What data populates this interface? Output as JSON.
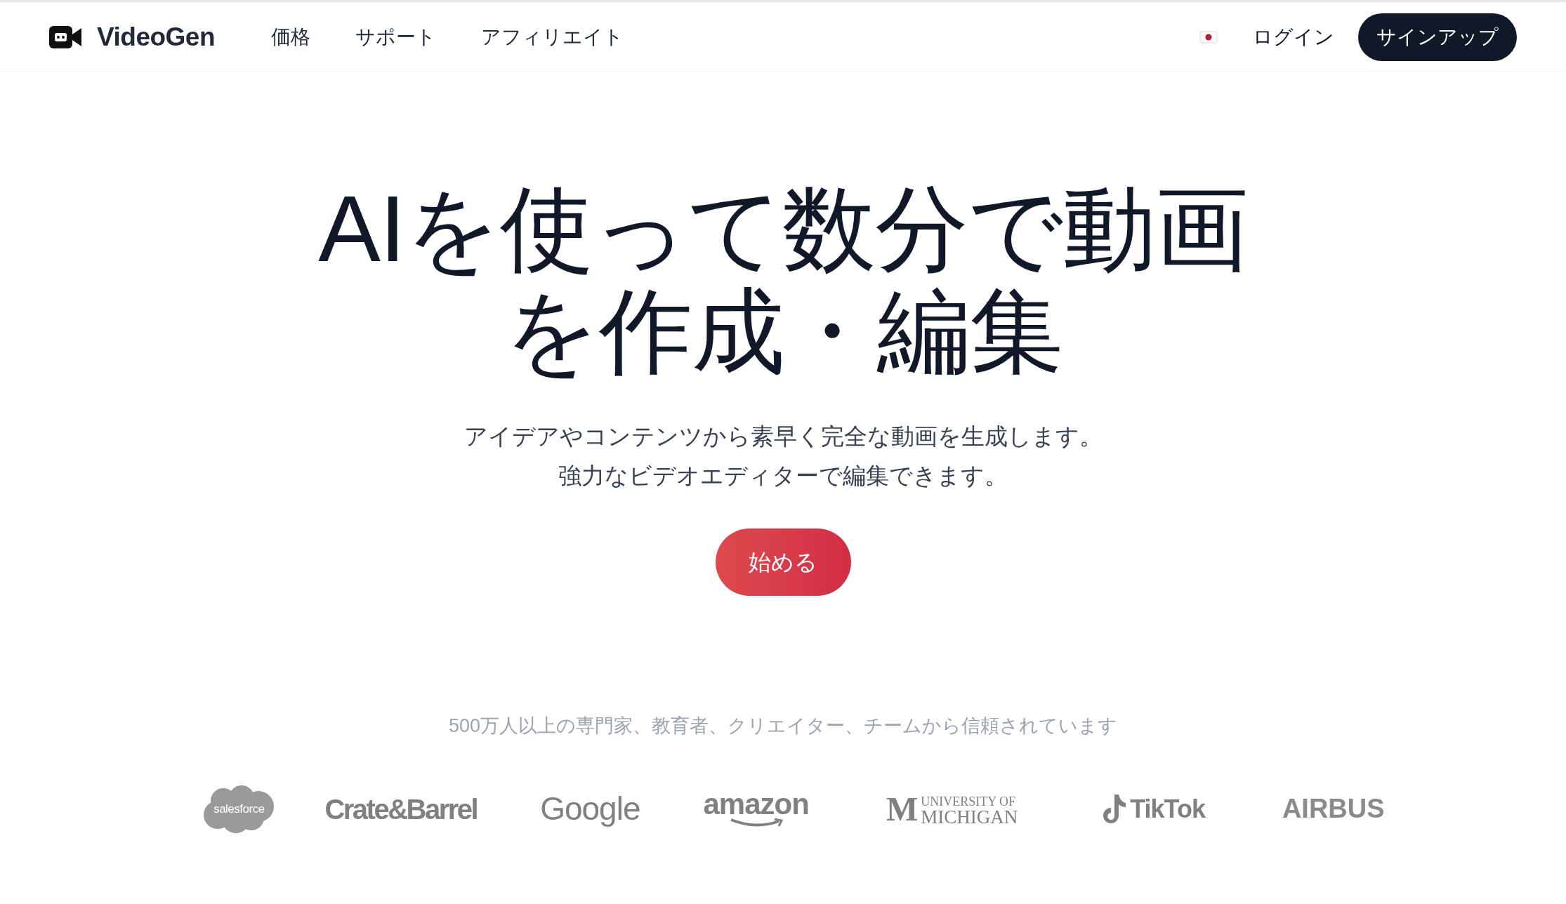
{
  "header": {
    "brand": "VideoGen",
    "nav": [
      "価格",
      "サポート",
      "アフィリエイト"
    ],
    "login": "ログイン",
    "signup": "サインアップ"
  },
  "hero": {
    "title": "AIを使って数分で動画を作成・編集",
    "subtitle_lines": [
      "アイデアやコンテンツから素早く完全な動画を生成します。",
      "強力なビデオエディターで編集できます。"
    ],
    "cta": "始める"
  },
  "trust": {
    "text": "500万人以上の専門家、教育者、クリエイター、チームから信頼されています",
    "logos": [
      {
        "kind": "cloud",
        "texts": [
          "salesforce"
        ]
      },
      {
        "kind": "wordmark",
        "texts": [
          "Crate&Barrel"
        ]
      },
      {
        "kind": "google",
        "texts": [
          "Google"
        ]
      },
      {
        "kind": "amazon",
        "texts": [
          "amazon"
        ]
      },
      {
        "kind": "university",
        "texts": [
          "M",
          "UNIVERSITY OF",
          "MICHIGAN"
        ]
      },
      {
        "kind": "note",
        "texts": [
          "TikTok"
        ]
      },
      {
        "kind": "wordmark_wide",
        "texts": [
          "AIRBUS"
        ]
      }
    ]
  }
}
